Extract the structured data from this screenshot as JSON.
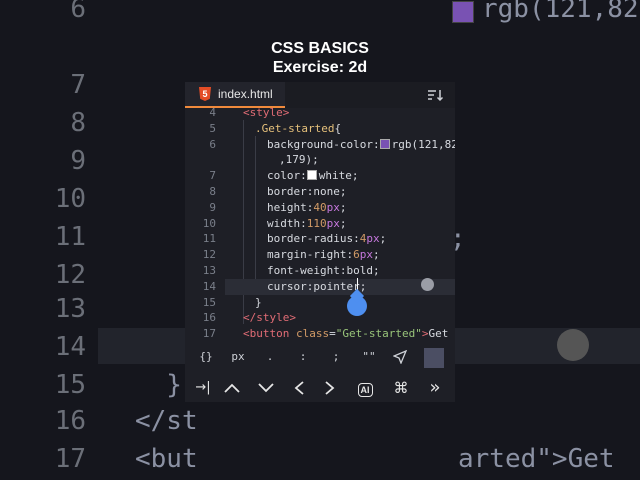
{
  "title": {
    "line1": "CSS BASICS",
    "line2": "Exercise: 2d"
  },
  "tab": {
    "filename": "index.html",
    "icon": "html5-icon",
    "icon_letter": "5"
  },
  "code_lines": [
    {
      "num": "4",
      "html": "<span class='tag'>&lt;style&gt;</span>",
      "indent": 0
    },
    {
      "num": "5",
      "html": "<span class='sel'>.Get-started</span>{",
      "indent": 1
    },
    {
      "num": "6",
      "html": "<span class='prop'>background-color</span>:<span class='swatch-inline' style='background:#7952b3'></span><span class='val'>rgb(121,82</span>",
      "indent": 2
    },
    {
      "num": "",
      "html": "<span class='val'>,179);</span>",
      "indent": 3
    },
    {
      "num": "7",
      "html": "<span class='prop'>color</span>:<span class='swatch-inline' style='background:#ffffff'></span><span class='val'>white;</span>",
      "indent": 2
    },
    {
      "num": "8",
      "html": "<span class='prop'>border</span>:<span class='val'>none;</span>",
      "indent": 2
    },
    {
      "num": "9",
      "html": "<span class='prop'>height</span>:<span class='num-v'>40</span><span class='unit'>px</span>;",
      "indent": 2
    },
    {
      "num": "10",
      "html": "<span class='prop'>width</span>:<span class='num-v'>110</span><span class='unit'>px</span>;",
      "indent": 2
    },
    {
      "num": "11",
      "html": "<span class='prop'>border-radius</span>:<span class='num-v'>4</span><span class='unit'>px</span>;",
      "indent": 2
    },
    {
      "num": "12",
      "html": "<span class='prop'>margin-right</span>:<span class='num-v'>6</span><span class='unit'>px</span>;",
      "indent": 2
    },
    {
      "num": "13",
      "html": "<span class='prop'>font-weight</span>:<span class='val'>bold;</span>",
      "indent": 2
    },
    {
      "num": "14",
      "html": "<span class='prop'>cursor</span>:<span class='val'>pointer;</span>",
      "indent": 2,
      "active": true
    },
    {
      "num": "15",
      "html": "}",
      "indent": 1
    },
    {
      "num": "16",
      "html": "<span class='tag'>&lt;/style&gt;</span>",
      "indent": 0
    },
    {
      "num": "17",
      "html": "<span class='tag'>&lt;button</span> <span class='attr'>class</span>=<span class='str'>\"Get-started\"</span><span class='tag'>&gt;</span>Get",
      "indent": 0
    }
  ],
  "toolbar_symbols": [
    "{}",
    "px",
    ".",
    ":",
    ";",
    "\"\""
  ],
  "toolbar_nav": [
    "tab-icon",
    "up-icon",
    "down-icon",
    "left-icon",
    "right-icon",
    "ai-icon",
    "command-icon",
    "fast-forward-icon"
  ],
  "toolbar_nav_glyphs": [
    "→|",
    "^",
    "v",
    "<",
    ">",
    "AI",
    "⌘",
    "»"
  ],
  "color_picker_color": "#4b4e63",
  "background_zoom": {
    "lines": [
      {
        "num": "6",
        "code": ""
      },
      {
        "num": "7",
        "code": ""
      },
      {
        "num": "8",
        "code": ""
      },
      {
        "num": "9",
        "code": ""
      },
      {
        "num": "10",
        "code": ""
      },
      {
        "num": "11",
        "code": ""
      },
      {
        "num": "12",
        "code": ""
      },
      {
        "num": "13",
        "code": ""
      },
      {
        "num": "14",
        "code": ""
      },
      {
        "num": "15",
        "code": "  }"
      },
      {
        "num": "16",
        "code": "</st"
      },
      {
        "num": "17",
        "code": "<but"
      }
    ],
    "right_texts": [
      "rgb(121,82",
      ";",
      "arted\">Get"
    ]
  }
}
